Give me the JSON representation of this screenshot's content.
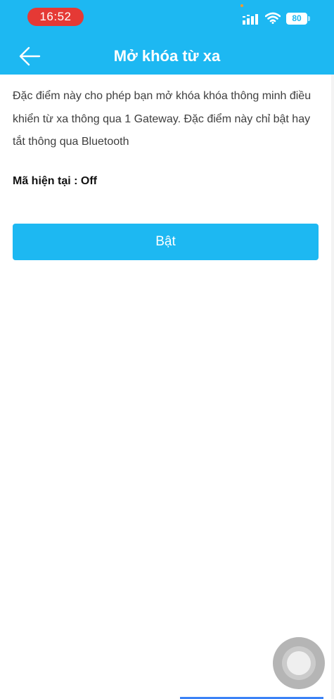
{
  "status_bar": {
    "time": "16:52",
    "battery": "80",
    "icons": [
      "cellular-signal-icon",
      "wifi-icon",
      "battery-icon"
    ]
  },
  "header": {
    "back_icon": "arrow-left-icon",
    "title": "Mở khóa từ xa"
  },
  "content": {
    "description": "Đặc điểm này cho phép bạn mở khóa khóa thông minh điều khiển từ xa thông qua 1 Gateway. Đặc điểm này chỉ bật hay tắt thông qua Bluetooth",
    "current_status": "Mã hiện tại : Off",
    "toggle_button_label": "Bật"
  },
  "colors": {
    "primary": "#1db8f2",
    "time_pill": "#e53935",
    "text": "#3e3e3e"
  }
}
